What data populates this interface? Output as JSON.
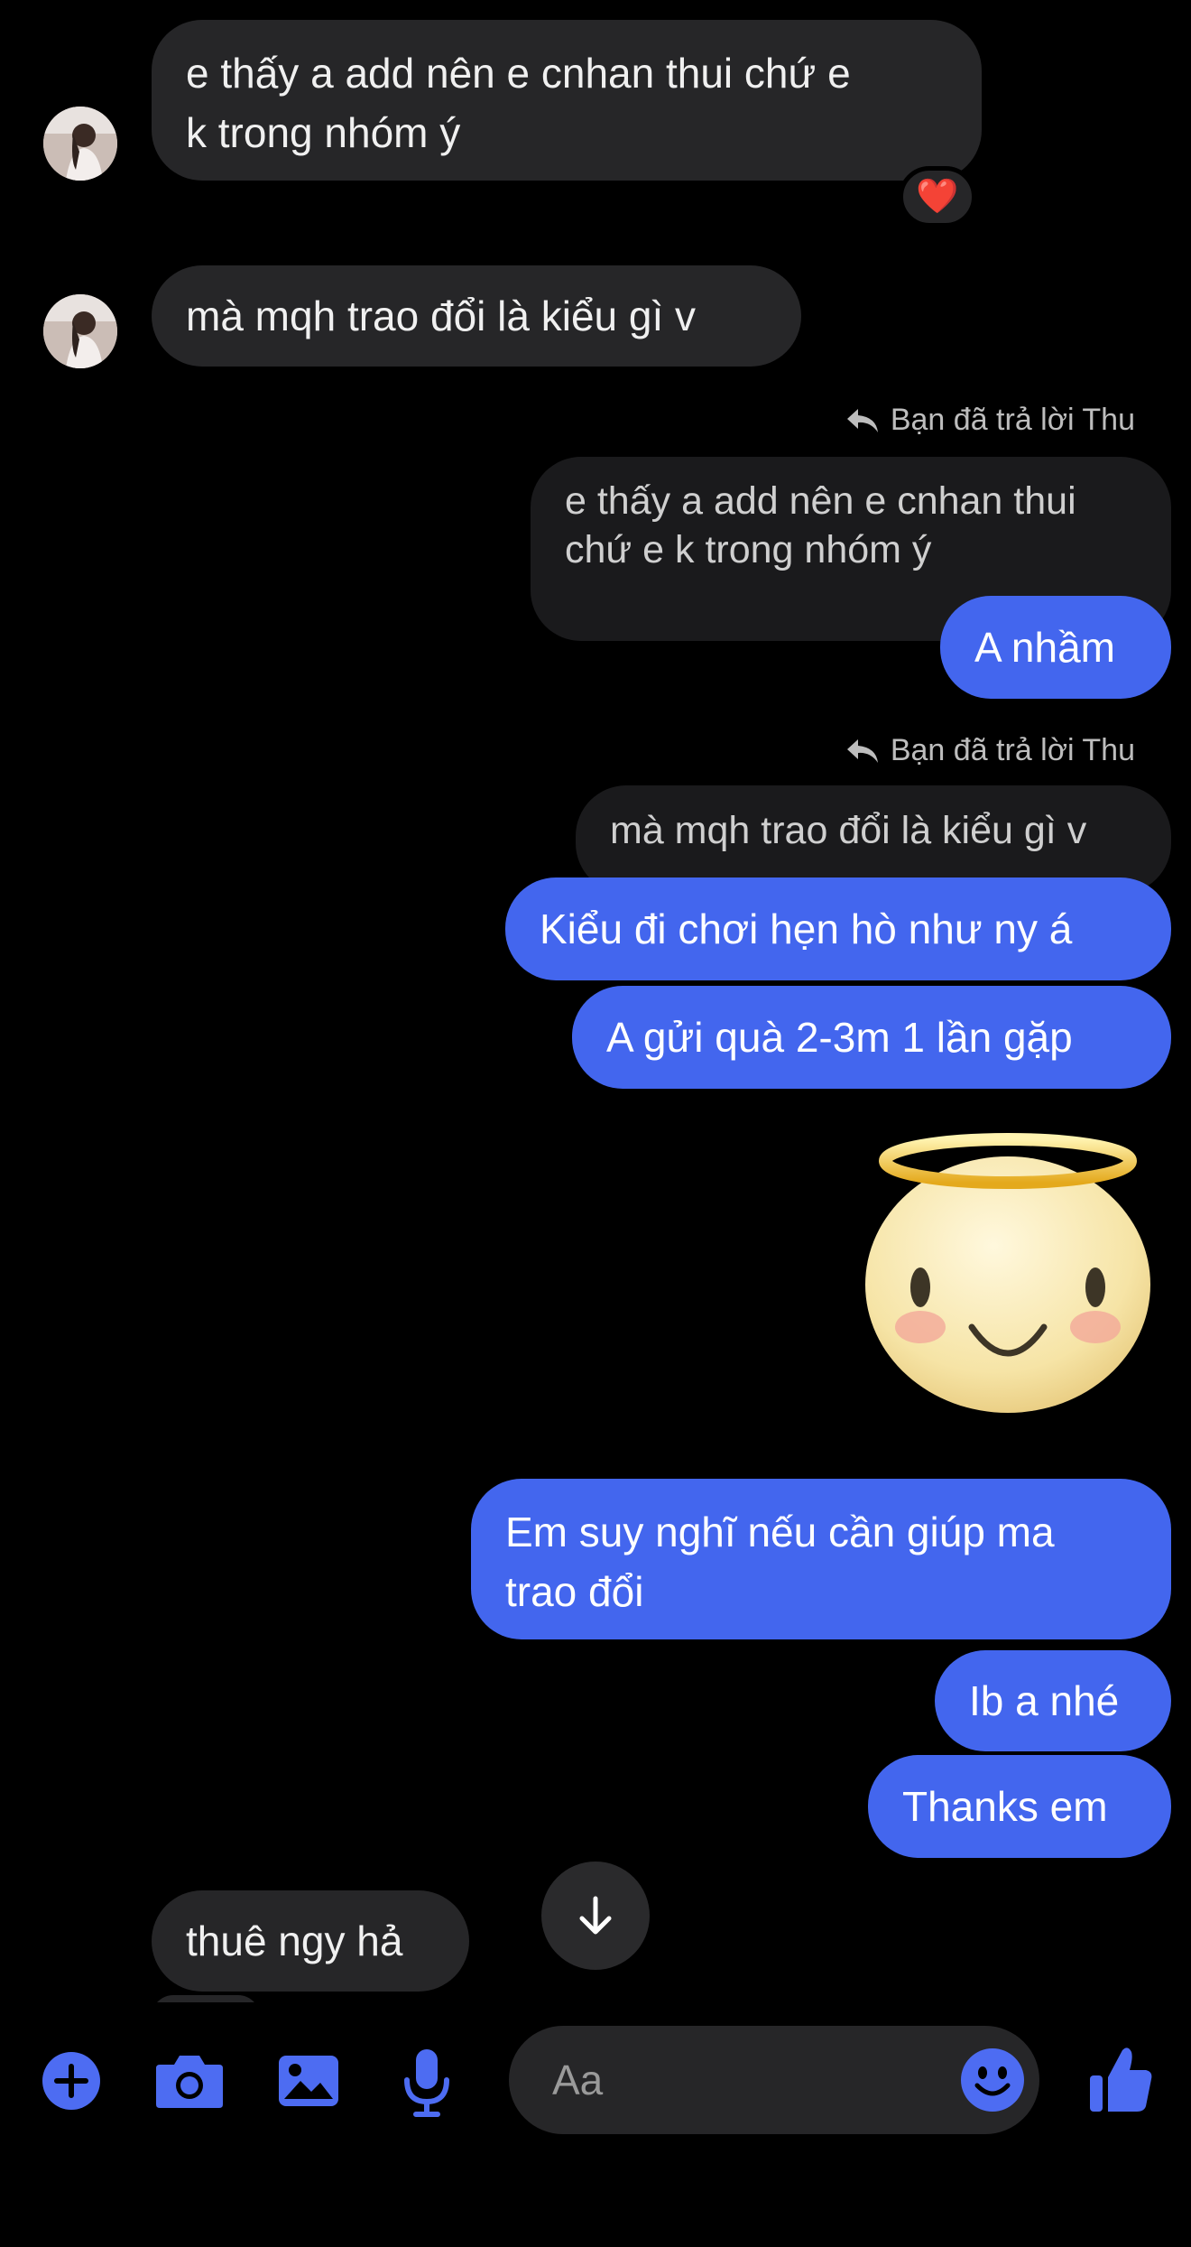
{
  "conversation": {
    "messages": [
      {
        "id": "m1",
        "direction": "in",
        "text": "e thấy a add nên e cnhan thui chứ e\nk trong nhóm ý",
        "reaction": "❤️"
      },
      {
        "id": "m2",
        "direction": "in",
        "text": "mà mqh trao đổi là kiểu gì v"
      },
      {
        "id": "m3",
        "direction": "out",
        "reply_label": "Bạn đã trả lời Thu",
        "quoted_text": "e thấy a add nên e cnhan thui\nchứ e k trong nhóm ý",
        "text": "A nhầm"
      },
      {
        "id": "m4",
        "direction": "out",
        "reply_label": "Bạn đã trả lời Thu",
        "quoted_text": "mà mqh trao đổi là kiểu gì v",
        "text": "Kiểu đi chơi hẹn hò như ny á"
      },
      {
        "id": "m5",
        "direction": "out",
        "text": "A gửi quà 2-3m 1 lần gặp"
      },
      {
        "id": "m6",
        "direction": "out",
        "sticker": "angel-smile-sticker"
      },
      {
        "id": "m7",
        "direction": "out",
        "text": "Em suy nghĩ nếu cần giúp ma\ntrao đổi"
      },
      {
        "id": "m8",
        "direction": "out",
        "text": "Ib a nhé"
      },
      {
        "id": "m9",
        "direction": "out",
        "text": "Thanks em"
      },
      {
        "id": "m10",
        "direction": "in",
        "text": "thuê ngy hả"
      }
    ]
  },
  "composer": {
    "placeholder": "Aa",
    "icons": [
      "plus-icon",
      "camera-icon",
      "image-icon",
      "microphone-icon",
      "emoji-icon",
      "thumbs-up-icon"
    ]
  },
  "colors": {
    "background": "#000000",
    "incoming_bubble": "#262628",
    "outgoing_bubble": "#4366ee",
    "quoted_bubble": "#1a1a1c",
    "accent": "#4366ee"
  }
}
